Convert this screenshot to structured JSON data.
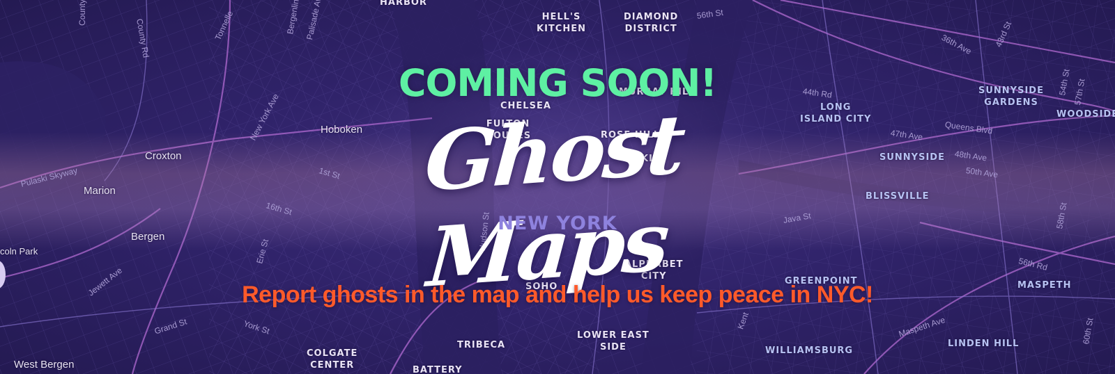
{
  "banner": {
    "coming_soon": "COMING SOON!",
    "logo_text": "Ghost Maps",
    "subtitle": "NEW YORK",
    "tagline": "Report ghosts in the map and help us keep peace in NYC!"
  },
  "colors": {
    "coming_soon": "#5ef0a3",
    "tagline": "#ff5a2a",
    "subtitle": "#8e82de",
    "background": "#2a1d55"
  },
  "map": {
    "neighborhoods": {
      "harbor": "HARBOR",
      "hells_kitchen": "HELL'S\nKITCHEN",
      "diamond_district": "DIAMOND\nDISTRICT",
      "murray_hill": "MURRAY HILL",
      "chelsea": "CHELSEA",
      "fulton_houses": "FULTON\nHOUSES",
      "rose_hill": "ROSE HILL",
      "kips_bay": "KIP",
      "long_island_city": "LONG\nISLAND CITY",
      "sunnyside_gardens": "SUNNYSIDE\nGARDENS",
      "woodside": "WOODSIDE",
      "sunnyside": "SUNNYSIDE",
      "blissville": "BLISSVILLE",
      "alphabet_city": "ALPHABET\nCITY",
      "soho": "SOHO",
      "greenpoint": "GREENPOINT",
      "maspeth": "MASPETH",
      "tribeca": "TRIBECA",
      "lower_east_side": "LOWER EAST\nSIDE",
      "colgate_center": "COLGATE\nCENTER",
      "battery": "BATTERY",
      "williamsburg": "WILLIAMSBURG",
      "linden_hill": "LINDEN HILL"
    },
    "towns": {
      "hoboken": "Hoboken",
      "croxton": "Croxton",
      "marion": "Marion",
      "bergen": "Bergen",
      "lincoln_park": "coln Park",
      "west_bergen": "West Bergen"
    },
    "streets": {
      "county_rd_1": "County Rd",
      "county_rd_2": "County Rd",
      "bergenline": "Bergenline",
      "palisade": "Palisade Av",
      "tonnelle": "Tonnelle",
      "new_york_ave": "New York Ave",
      "pulaski": "Pulaski Skyway",
      "st_1st": "1st St",
      "st_16th": "16th St",
      "erie": "Erie St",
      "jewett": "Jewett Ave",
      "york": "York St",
      "grand": "Grand St",
      "hudson": "Hudson St",
      "st_56th": "56th St",
      "st_44th": "44th Rd",
      "st_36th": "36th Ave",
      "st_43rd": "43rd St",
      "ave_47th": "47th Ave",
      "queens_blvd": "Queens Blvd",
      "ave_48th": "48th Ave",
      "ave_50th": "50th Ave",
      "java": "Java St",
      "st_58th": "58th St",
      "rd_56th": "56th Rd",
      "maspeth_ave": "Maspeth Ave",
      "st_60th": "60th St",
      "st_54th": "54th St",
      "st_57th": "57th St",
      "kent": "Kent"
    }
  }
}
